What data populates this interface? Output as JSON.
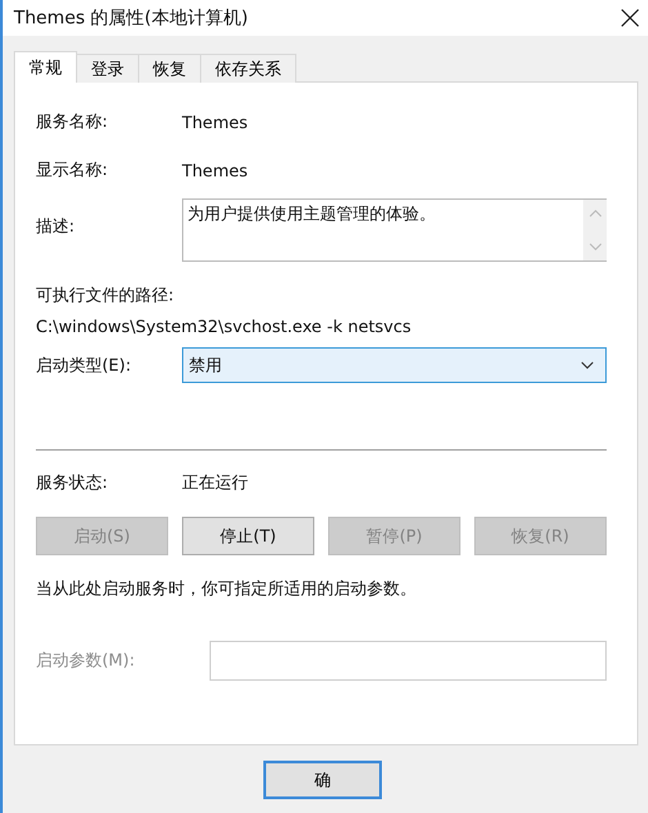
{
  "window": {
    "title": "Themes 的属性(本地计算机)"
  },
  "tabs": [
    {
      "label": "常规",
      "selected": true
    },
    {
      "label": "登录",
      "selected": false
    },
    {
      "label": "恢复",
      "selected": false
    },
    {
      "label": "依存关系",
      "selected": false
    }
  ],
  "service_name": {
    "label": "服务名称:",
    "value": "Themes"
  },
  "display_name": {
    "label": "显示名称:",
    "value": "Themes"
  },
  "description": {
    "label": "描述:",
    "value": "为用户提供使用主题管理的体验。"
  },
  "executable_path": {
    "label": "可执行文件的路径:",
    "value": "C:\\windows\\System32\\svchost.exe -k netsvcs"
  },
  "startup_type": {
    "label": "启动类型(E):",
    "value": "禁用"
  },
  "service_status": {
    "label": "服务状态:",
    "value": "正在运行"
  },
  "control_buttons": [
    {
      "label": "启动(S)",
      "disabled": true
    },
    {
      "label": "停止(T)",
      "disabled": false
    },
    {
      "label": "暂停(P)",
      "disabled": true
    },
    {
      "label": "恢复(R)",
      "disabled": true
    }
  ],
  "hint": "当从此处启动服务时，你可指定所适用的启动参数。",
  "start_parameters": {
    "label": "启动参数(M):",
    "disabled": true
  },
  "dialog_buttons": [
    {
      "label": "确"
    }
  ]
}
